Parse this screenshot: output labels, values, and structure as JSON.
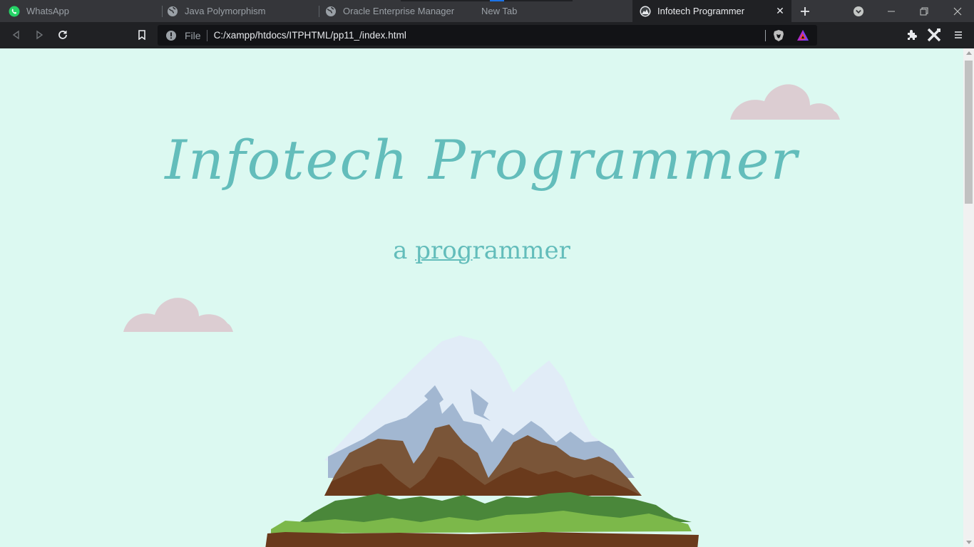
{
  "tabs": [
    {
      "title": "WhatsApp",
      "icon": "whatsapp-icon",
      "active": false
    },
    {
      "title": "Java Polymorphism",
      "icon": "globe-icon",
      "active": false
    },
    {
      "title": "Oracle Enterprise Manager",
      "icon": "globe-icon",
      "active": false
    },
    {
      "title": "New Tab",
      "icon": "",
      "active": false
    },
    {
      "title": "Infotech Programmer",
      "icon": "site-favicon",
      "active": true
    }
  ],
  "tab_close_glyph": "✕",
  "toolbar": {
    "scheme_label": "File",
    "url": "C:/xampp/htdocs/ITPHTML/pp11_/index.html"
  },
  "page": {
    "title": "Infotech Programmer",
    "subtitle_prefix": "a ",
    "subtitle_underlined": "prog",
    "subtitle_rest": "rammer"
  },
  "colors": {
    "page_background": "#dcf9f1",
    "title_color": "#63bdbb",
    "cloud_color": "#dccdd2",
    "browser_frame": "#202124",
    "tab_strip": "#35363a"
  }
}
